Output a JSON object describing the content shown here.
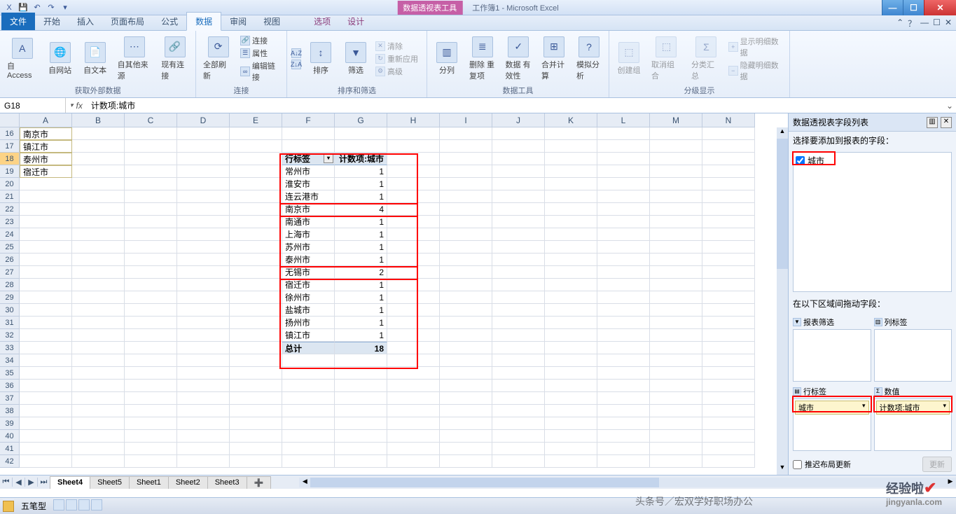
{
  "title": {
    "context": "数据透视表工具",
    "doc": "工作簿1 - Microsoft Excel"
  },
  "qat": {
    "save": "💾",
    "undo": "↶",
    "redo": "↷",
    "more": "▾"
  },
  "winbtns": {
    "min": "—",
    "max": "☐",
    "close": "✕"
  },
  "ribtabs": [
    "文件",
    "开始",
    "插入",
    "页面布局",
    "公式",
    "数据",
    "审阅",
    "视图"
  ],
  "ribtabs_ctx": [
    "选项",
    "设计"
  ],
  "ribhelp": {
    "help": "？",
    "caret": "⌃",
    "minr": "☐",
    "ex": "✕"
  },
  "ribbon": {
    "g1": {
      "label": "获取外部数据",
      "btns": [
        "自 Access",
        "自网站",
        "自文本",
        "自其他来源",
        "现有连接"
      ]
    },
    "g2": {
      "label": "连接",
      "main": "全部刷新",
      "sub": [
        "连接",
        "属性",
        "编辑链接"
      ]
    },
    "g3": {
      "label": "排序和筛选",
      "sort": "排序",
      "filter": "筛选",
      "sub": [
        "清除",
        "重新应用",
        "高级"
      ],
      "az": "A↓Z",
      "za": "Z↓A"
    },
    "g4": {
      "label": "数据工具",
      "btns": [
        "分列",
        "删除 重复项",
        "数据 有效性",
        "合并计算",
        "模拟分析"
      ]
    },
    "g5": {
      "label": "分级显示",
      "btns": [
        "创建组",
        "取消组合",
        "分类汇总"
      ],
      "sub": [
        "显示明细数据",
        "隐藏明细数据"
      ]
    }
  },
  "namebar": {
    "name": "G18",
    "fx": "fx",
    "formula": "计数项:城市"
  },
  "cols": [
    "A",
    "B",
    "C",
    "D",
    "E",
    "F",
    "G",
    "H",
    "I",
    "J",
    "K",
    "L",
    "M",
    "N"
  ],
  "leftdata": {
    "16": "南京市",
    "17": "镇江市",
    "18": "泰州市",
    "19": "宿迁市"
  },
  "pivot": {
    "hdr_row": "行标签",
    "hdr_val": "计数项:城市",
    "rows": [
      {
        "k": "常州市",
        "v": 1
      },
      {
        "k": "淮安市",
        "v": 1
      },
      {
        "k": "连云港市",
        "v": 1
      },
      {
        "k": "南京市",
        "v": 4
      },
      {
        "k": "南通市",
        "v": 1
      },
      {
        "k": "上海市",
        "v": 1
      },
      {
        "k": "苏州市",
        "v": 1
      },
      {
        "k": "泰州市",
        "v": 1
      },
      {
        "k": "无锡市",
        "v": 2
      },
      {
        "k": "宿迁市",
        "v": 1
      },
      {
        "k": "徐州市",
        "v": 1
      },
      {
        "k": "盐城市",
        "v": 1
      },
      {
        "k": "扬州市",
        "v": 1
      },
      {
        "k": "镇江市",
        "v": 1
      }
    ],
    "total_k": "总计",
    "total_v": 18
  },
  "sheets": {
    "nav": [
      "⏮",
      "◀",
      "▶",
      "⏭"
    ],
    "tabs": [
      "Sheet4",
      "Sheet5",
      "Sheet1",
      "Sheet2",
      "Sheet3"
    ],
    "active": 0,
    "plus": "➕"
  },
  "pane": {
    "title": "数据透视表字段列表",
    "opts": "▥",
    "prompt": "选择要添加到报表的字段：",
    "fields": [
      {
        "label": "城市",
        "checked": true
      }
    ],
    "areas_prompt": "在以下区域间拖动字段：",
    "area_filter": "报表筛选",
    "area_col": "列标签",
    "area_row": "行标签",
    "area_val": "数值",
    "sigma": "Σ",
    "row_item": "城市",
    "val_item": "计数项:城市",
    "defer": "推迟布局更新",
    "update": "更新"
  },
  "taskbar": {
    "ime": "五笔型"
  },
  "wm": {
    "main": "经验啦",
    "site": "jingyanla.com",
    "toutiao": "头条号／宏双学好职场办公"
  }
}
